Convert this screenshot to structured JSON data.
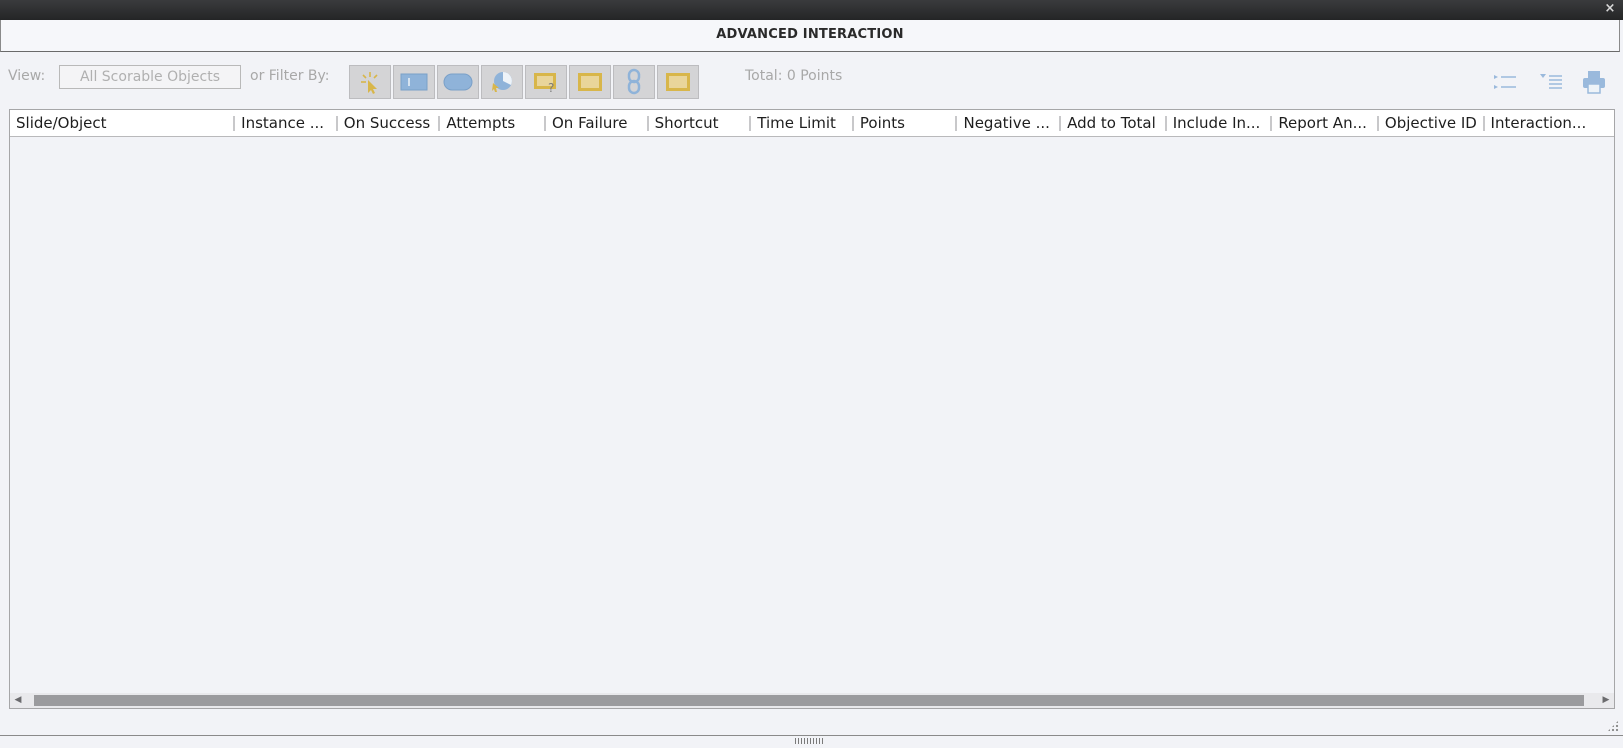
{
  "window": {
    "title": "ADVANCED INTERACTION",
    "close_glyph": "×"
  },
  "toolbar": {
    "view_label": "View:",
    "view_value": "All Scorable Objects",
    "filter_label": "or Filter By:",
    "total_label": "Total: 0 Points",
    "filter_buttons": [
      "click-box-filter-icon",
      "text-entry-box-filter-icon",
      "button-filter-icon",
      "drag-drop-filter-icon",
      "quiz-question-filter-icon",
      "slide-filter-icon",
      "hyperlink-filter-icon",
      "widget-filter-icon"
    ],
    "right_icons": [
      "expand-all-icon",
      "collapse-all-icon",
      "print-icon"
    ]
  },
  "grid": {
    "columns": [
      "Slide/Object",
      "Instance ...",
      "On Success",
      "Attempts",
      "On Failure",
      "Shortcut",
      "Time Limit",
      "Points",
      "Negative ...",
      "Add to Total",
      "Include In...",
      "Report An...",
      "Objective ID",
      "Interaction..."
    ],
    "rows": []
  },
  "colors": {
    "accent_blue": "#8fb3d9",
    "accent_yellow": "#d8b64a",
    "titlebar_dark": "#2c2d2f"
  }
}
